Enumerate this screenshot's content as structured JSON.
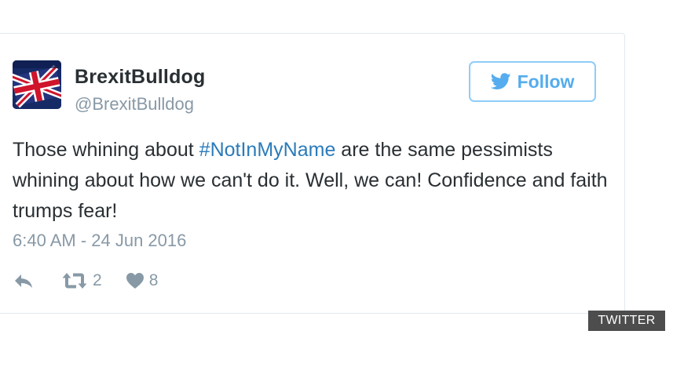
{
  "tweet": {
    "display_name": "BrexitBulldog",
    "handle": "@BrexitBulldog",
    "follow_label": "Follow",
    "text_before_hashtag": "Those whining about ",
    "hashtag": "#NotInMyName",
    "text_after_hashtag": " are the same pessimists whining about how we can't do it. Well, we can! Confidence and faith trumps fear!",
    "timestamp": "6:40 AM - 24 Jun 2016",
    "retweet_count": "2",
    "like_count": "8"
  },
  "source_label": "TWITTER",
  "icons": {
    "avatar": "union-jack-flag-avatar",
    "follow": "twitter-bird-icon",
    "reply": "reply-icon",
    "retweet": "retweet-icon",
    "like": "heart-icon"
  },
  "colors": {
    "twitter_blue": "#55acee",
    "follow_border": "#8ecdf8",
    "hashtag": "#2b7bb9",
    "text": "#292f33",
    "muted": "#8899a6",
    "label_bg": "#4d4d4d"
  }
}
